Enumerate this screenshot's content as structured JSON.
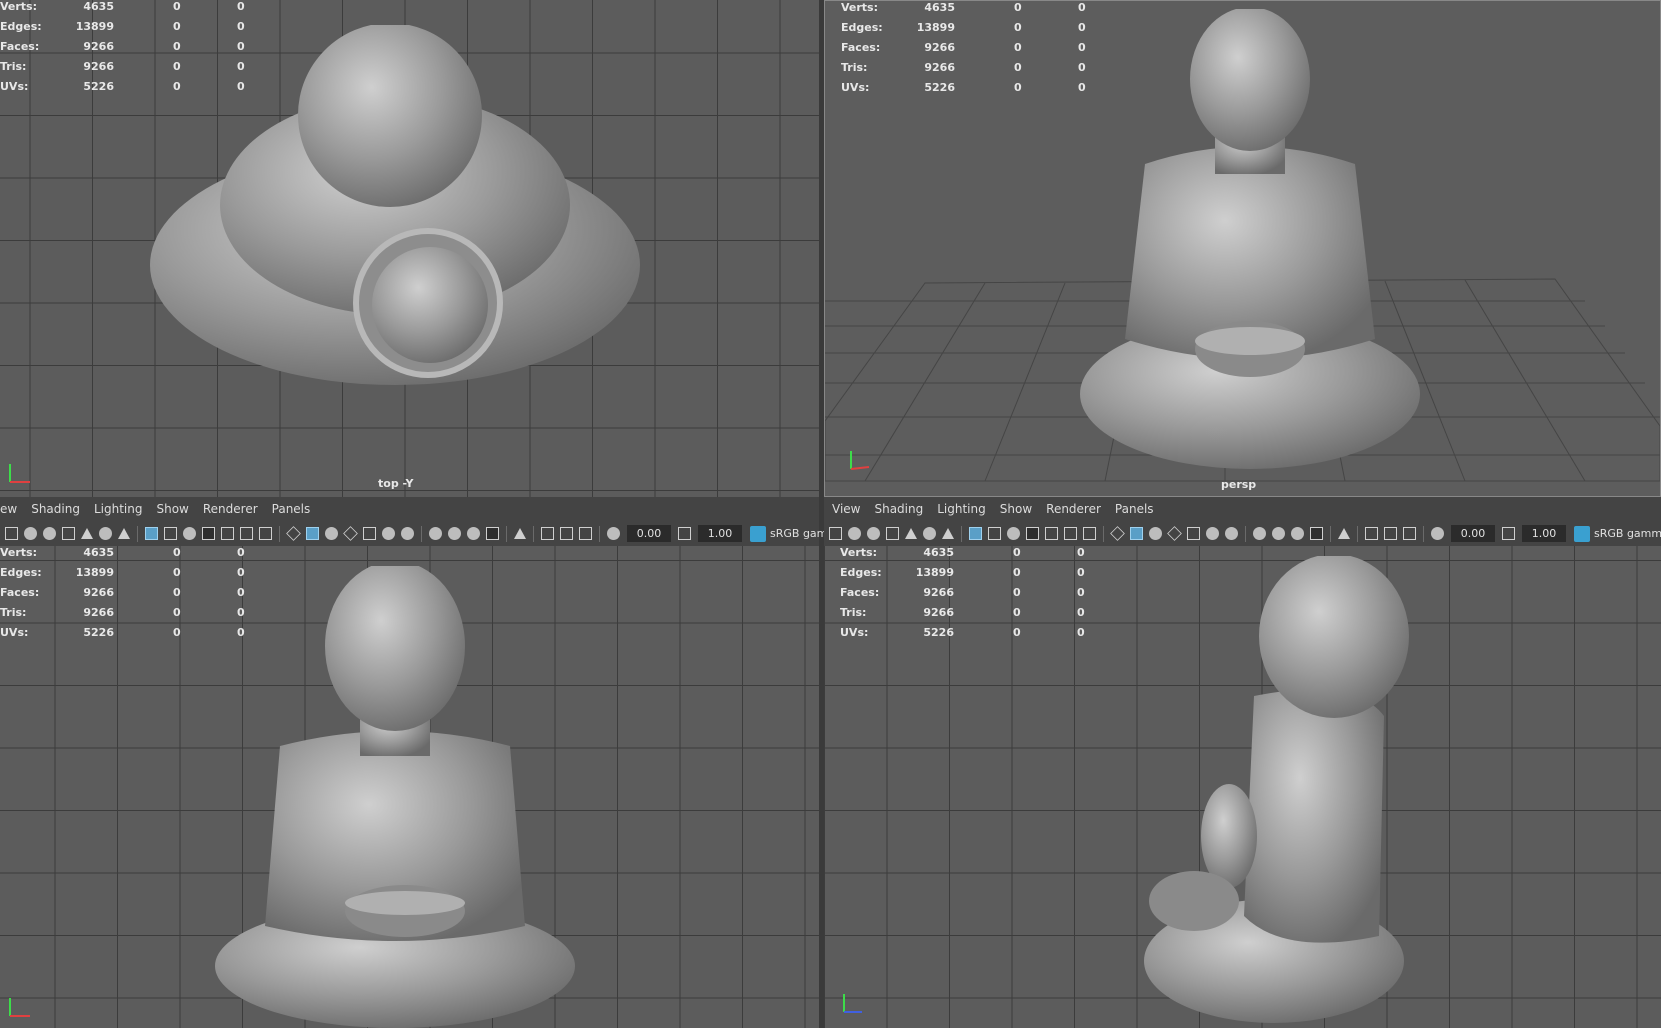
{
  "stats": {
    "rows": [
      {
        "label": "Verts:",
        "v0": "4635",
        "v1": "0",
        "v2": "0"
      },
      {
        "label": "Edges:",
        "v0": "13899",
        "v1": "0",
        "v2": "0"
      },
      {
        "label": "Faces:",
        "v0": "9266",
        "v1": "0",
        "v2": "0"
      },
      {
        "label": "Tris:",
        "v0": "9266",
        "v1": "0",
        "v2": "0"
      },
      {
        "label": "UVs:",
        "v0": "5226",
        "v1": "0",
        "v2": "0"
      }
    ]
  },
  "viewports": {
    "top": {
      "camera": "top -Y"
    },
    "persp": {
      "camera": "persp"
    }
  },
  "panel_left": {
    "menu": [
      "ew",
      "Shading",
      "Lighting",
      "Show",
      "Renderer",
      "Panels"
    ],
    "field_a": "0.00",
    "field_b": "1.00",
    "color_space": "sRGB gamm"
  },
  "panel_right": {
    "menu": [
      "View",
      "Shading",
      "Lighting",
      "Show",
      "Renderer",
      "Panels"
    ],
    "field_a": "0.00",
    "field_b": "1.00",
    "color_space": "sRGB gamm"
  },
  "icons": [
    "camera-icon",
    "grid-icon",
    "wireframe-icon",
    "smooth-shade-icon",
    "light-icon",
    "isolate-icon",
    "xray-icon",
    "exposure-icon",
    "gamma-icon",
    "color-management-icon"
  ]
}
